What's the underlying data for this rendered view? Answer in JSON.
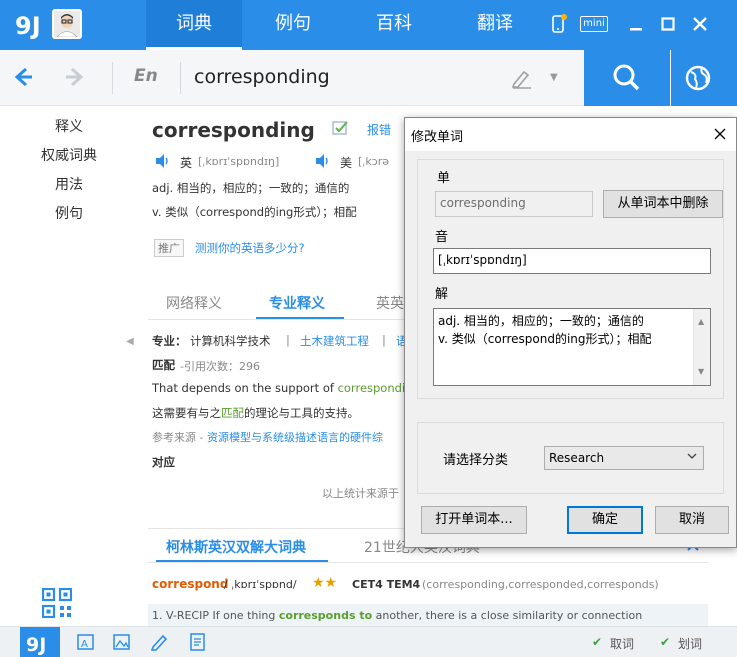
{
  "topbar": {
    "tabs": [
      {
        "label": "词典"
      },
      {
        "label": "例句"
      },
      {
        "label": "百科"
      },
      {
        "label": "翻译"
      }
    ],
    "mini_label": "mini"
  },
  "search": {
    "lang": "En",
    "query": "corresponding"
  },
  "sidenav": {
    "items": [
      {
        "label": "释义"
      },
      {
        "label": "权威词典"
      },
      {
        "label": "用法"
      },
      {
        "label": "例句"
      }
    ]
  },
  "entry": {
    "headword": "corresponding",
    "report_label": "报错",
    "uk_label": "英",
    "uk_phonetic": "[ˌkɒrɪˈspɒndɪŋ]",
    "us_label": "美",
    "us_phonetic": "[ˌkɔrə",
    "def1": "adj. 相当的，相应的；一致的；通信的",
    "def2": "v. 类似（correspond的ing形式）；相配",
    "promo_tag": "推广",
    "promo_link": "测测你的英语多少分?"
  },
  "deftabs": {
    "tab1": "网络释义",
    "tab2": "专业释义",
    "tab3": "英英"
  },
  "professional": {
    "field_label": "专业：",
    "field_value": "计算机科学技术",
    "sep1": "|",
    "field2": "土木建筑工程",
    "sep2": "|",
    "field3": "语",
    "word": "匹配",
    "cite": "-引用次数：296",
    "example_en_prefix": "That depends on the support of ",
    "example_en_hl": "correspondin",
    "example_cn_pre": "这需要有与之",
    "example_cn_hl": "匹配",
    "example_cn_post": "的理论与工具的支持。",
    "source_label": "参考来源 - ",
    "source_link": "资源模型与系统级描述语言的硬件综",
    "word2": "对应",
    "stats_note": "以上统计来源于"
  },
  "collins": {
    "tab1": "柯林斯英汉双解大词典",
    "tab2": "21世纪大英汉词典",
    "word": "correspond",
    "phonetic": "/ ˌkɒrɪˈspɒnd/",
    "stars": "★★",
    "level": "CET4 TEM4",
    "forms": "(corresponding,corresponded,corresponds)",
    "sense": "1.  V-RECIP If one thing ",
    "sense_hl": "corresponds to",
    "sense_post": " another, there is a close similarity or connection"
  },
  "bottombar": {
    "fetch_label": "取词",
    "select_label": "划词"
  },
  "dialog": {
    "title": "修改单词",
    "word_label": "单",
    "word_value": "corresponding",
    "delete_btn": "从单词本中删除",
    "phonetic_label": "音",
    "phonetic_value": "[ˌkɒrɪˈspɒndɪŋ]",
    "def_label": "解",
    "def_line1": "adj. 相当的，相应的；一致的；通信的",
    "def_line2": "v. 类似（correspond的ing形式）；相配",
    "category_label": "请选择分类",
    "category_value": "Research",
    "open_btn": "打开单词本...",
    "ok_btn": "确定",
    "cancel_btn": "取消"
  },
  "colors": {
    "brand": "#2a8ee8",
    "highlight_orange": "#e35b00",
    "highlight_green": "#5a9e2e"
  }
}
